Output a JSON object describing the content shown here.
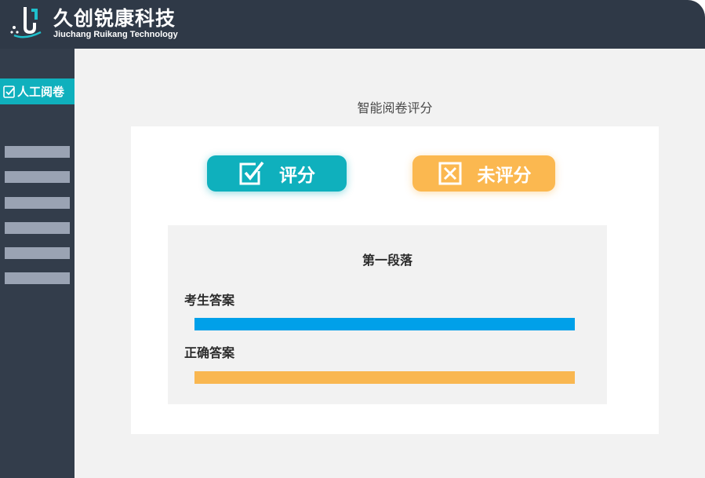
{
  "header": {
    "brand_cn": "久创锐康科技",
    "brand_en": "Jiuchang Ruikang Technology"
  },
  "sidebar": {
    "active_item": {
      "label": "人工阅卷",
      "icon": "check-box-icon"
    },
    "placeholder_count": 6
  },
  "main": {
    "title": "智能阅卷评分",
    "buttons": {
      "score": {
        "label": "评分",
        "icon": "check-box-icon",
        "color": "#0fb0bd"
      },
      "unscored": {
        "label": "未评分",
        "icon": "x-box-icon",
        "color": "#fbb850"
      }
    },
    "panel": {
      "paragraph_title": "第一段落",
      "student_answer_label": "考生答案",
      "correct_answer_label": "正确答案",
      "student_bar_color": "#00a0e9",
      "correct_bar_color": "#f9b751"
    }
  },
  "colors": {
    "header_bg": "#2f3947",
    "sidebar_bg": "#333d4b",
    "accent": "#0fb0bd",
    "page_bg": "#f2f2f2"
  }
}
